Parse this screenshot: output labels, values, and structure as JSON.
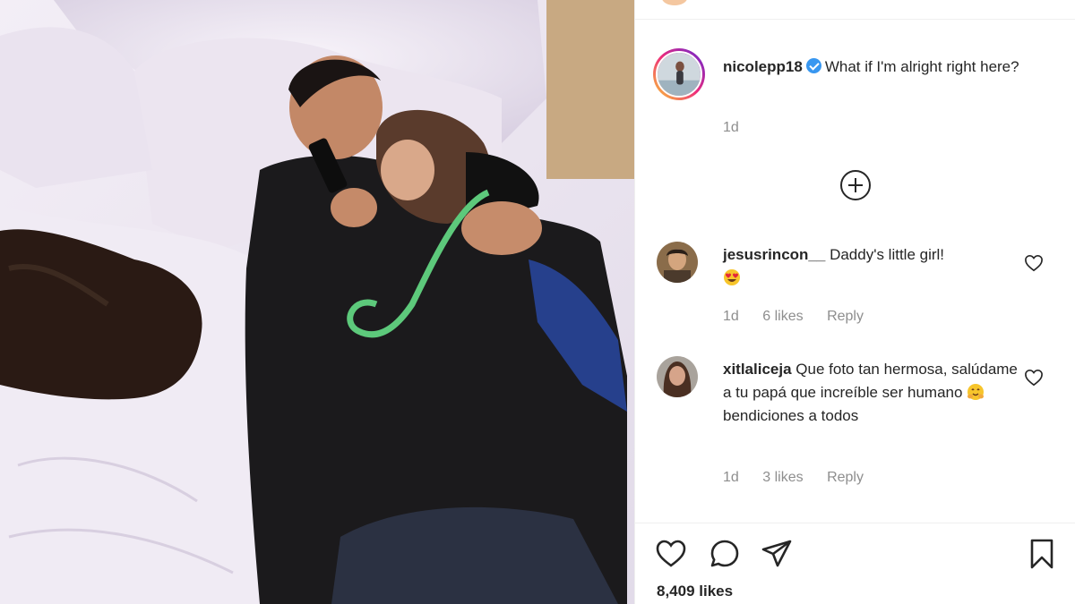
{
  "post": {
    "author": "nicolepp18",
    "caption": "What if I'm alright right here?",
    "time": "1d",
    "likes": "8,409 likes"
  },
  "comments": [
    {
      "username": "jesusrincon__",
      "text": "Daddy's little girl!",
      "emoji": "heart-eyes-emoji",
      "time": "1d",
      "likes": "6 likes",
      "reply": "Reply"
    },
    {
      "username": "xitlaliceja",
      "text_before_emoji": "Que foto tan hermosa, salúdame a tu papá que increíble ser humano",
      "emoji": "hugging-face-emoji",
      "text_after_emoji": "bendiciones a todos",
      "time": "1d",
      "likes": "3 likes",
      "reply": "Reply"
    }
  ],
  "icons": {
    "like": "heart-icon",
    "comment": "comment-icon",
    "share": "paper-plane-icon",
    "save": "bookmark-icon",
    "load_more": "plus-circle-icon",
    "verified": "verified-badge-icon"
  },
  "colors": {
    "verified": "#3897f0",
    "text": "#262626",
    "secondary": "#8e8e8e"
  }
}
